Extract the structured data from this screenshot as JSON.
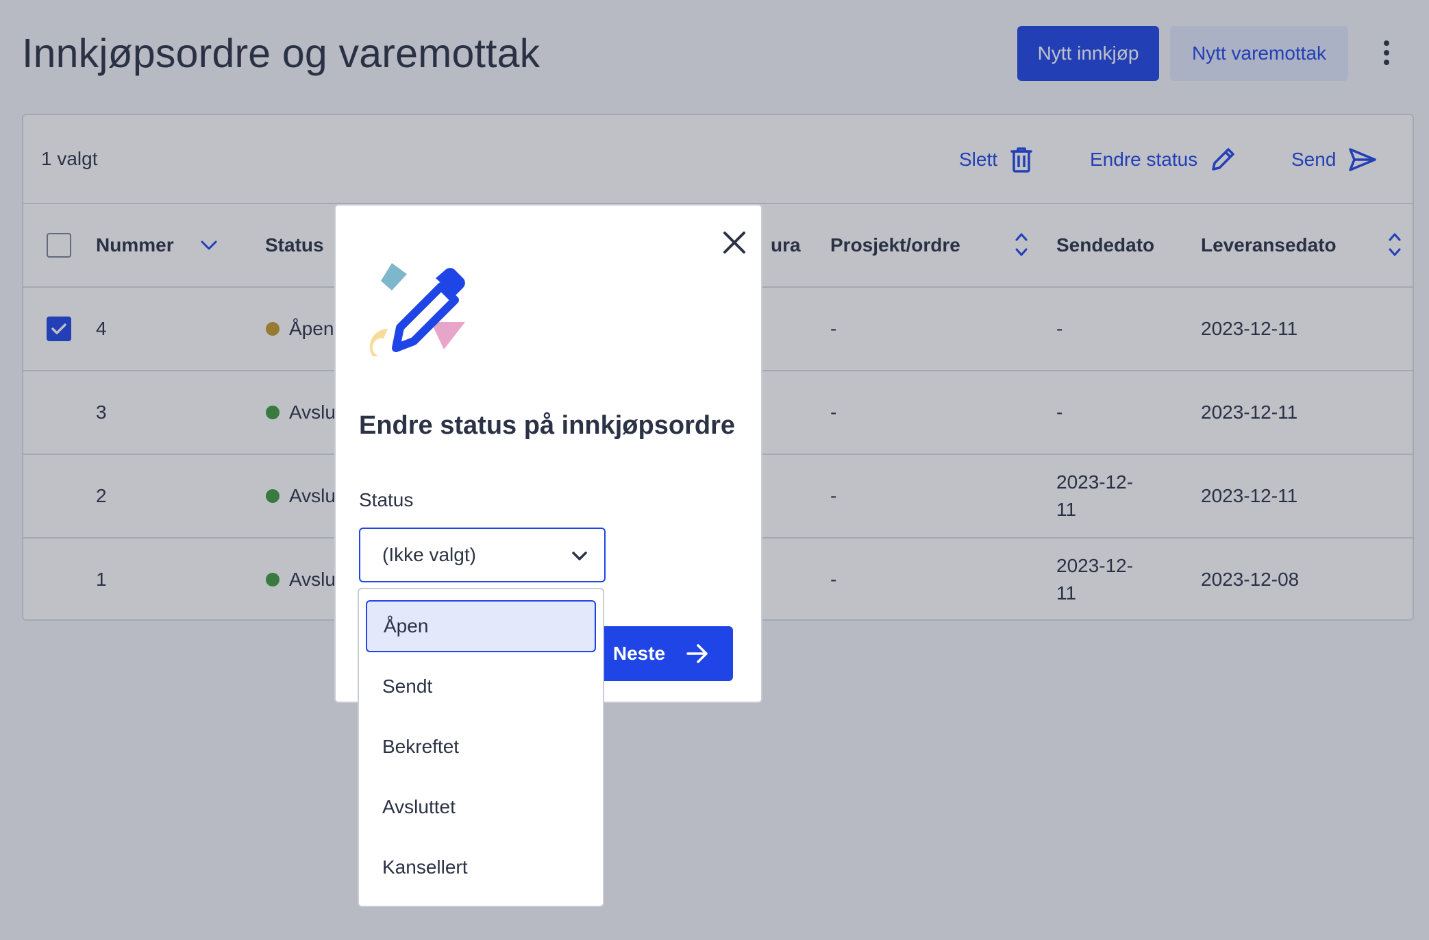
{
  "header": {
    "title": "Innkjøpsordre og varemottak",
    "new_purchase_label": "Nytt innkjøp",
    "new_receipt_label": "Nytt varemottak",
    "more_icon": "kebab-vertical-icon"
  },
  "toolbar": {
    "selected_count": "1 valgt",
    "delete_label": "Slett",
    "delete_icon": "trash-icon",
    "change_status_label": "Endre status",
    "change_status_icon": "pencil-icon",
    "send_label": "Send",
    "send_icon": "send-icon"
  },
  "table": {
    "columns": {
      "number": "Nummer",
      "status": "Status",
      "supplier_partial": "ura",
      "project": "Prosjekt/ordre",
      "send_date": "Sendedato",
      "delivery_date": "Leveransedato"
    },
    "rows": [
      {
        "number": "4",
        "status": "Åpen",
        "status_color": "#c79a2c",
        "selected": true,
        "project": "-",
        "send_date_line1": "-",
        "send_date_line2": "",
        "delivery_date": "2023-12-11"
      },
      {
        "number": "3",
        "status": "Avslu",
        "status_color": "#3f9a3f",
        "selected": false,
        "project": "-",
        "send_date_line1": "-",
        "send_date_line2": "",
        "delivery_date": "2023-12-11"
      },
      {
        "number": "2",
        "status": "Avslu",
        "status_color": "#3f9a3f",
        "selected": false,
        "project": "-",
        "send_date_line1": "2023-12-",
        "send_date_line2": "11",
        "delivery_date": "2023-12-11"
      },
      {
        "number": "1",
        "status": "Avslu",
        "status_color": "#3f9a3f",
        "selected": false,
        "project": "-",
        "send_date_line1": "2023-12-",
        "send_date_line2": "11",
        "delivery_date": "2023-12-08"
      }
    ]
  },
  "modal": {
    "title": "Endre status på innkjøpsordre",
    "status_label": "Status",
    "select_value": "(Ikke valgt)",
    "next_label": "Neste",
    "close_icon": "close-icon",
    "illustration": "pencil-illustration"
  },
  "dropdown": {
    "options": [
      "Åpen",
      "Sendt",
      "Bekreftet",
      "Avsluttet",
      "Kansellert"
    ],
    "highlighted": "Åpen"
  },
  "colors": {
    "primary": "#1f45e6",
    "secondary_bg": "#e3e8fb",
    "text": "#2b3245",
    "open_status": "#c79a2c",
    "closed_status": "#3f9a3f"
  }
}
